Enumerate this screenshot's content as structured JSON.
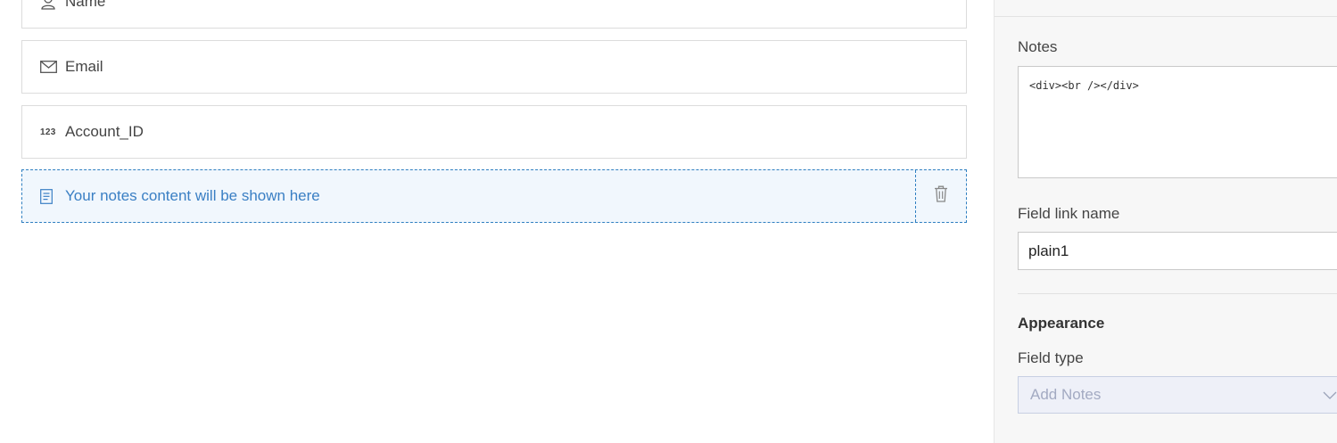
{
  "form_fields": [
    {
      "label": "Name",
      "icon": "user-icon"
    },
    {
      "label": "Email",
      "icon": "mail-icon"
    },
    {
      "label": "Account_ID",
      "icon": "number-icon",
      "badge": "123"
    },
    {
      "label": "Your notes content will be shown here",
      "icon": "notes-icon",
      "selected": true
    }
  ],
  "properties": {
    "notes_label": "Notes",
    "notes_value": "<div><br /></div>",
    "field_link_label": "Field link name",
    "field_link_value": "plain1",
    "appearance_heading": "Appearance",
    "field_type_label": "Field type",
    "field_type_value": "Add Notes"
  },
  "colors": {
    "selected_border": "#2f7fc1",
    "selected_bg": "#f1f7fd",
    "selected_text": "#3a7fc4",
    "panel_bg": "#f7f7f7"
  }
}
